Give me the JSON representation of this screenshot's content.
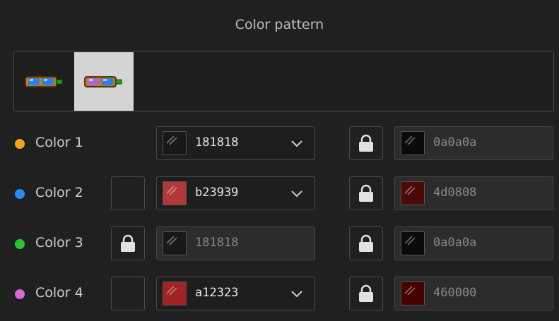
{
  "title": "Color pattern",
  "patterns": [
    {
      "name": "goggles-pattern-1",
      "selected": false
    },
    {
      "name": "goggles-pattern-2",
      "selected": true
    }
  ],
  "rows": [
    {
      "label": "Color 1",
      "dot_color": "#f5a31a",
      "left_lock": "none",
      "main": {
        "hex": "181818",
        "swatch": "#181818",
        "dropdown": true
      },
      "shade": {
        "hex": "0a0a0a",
        "swatch": "#0a0a0a"
      }
    },
    {
      "label": "Color 2",
      "dot_color": "#2a8cf0",
      "left_lock": "unlocked",
      "main": {
        "hex": "b23939",
        "swatch": "#b23939",
        "dropdown": true
      },
      "shade": {
        "hex": "4d0808",
        "swatch": "#4d0808"
      }
    },
    {
      "label": "Color 3",
      "dot_color": "#2ec42e",
      "left_lock": "locked",
      "main": {
        "hex": "181818",
        "swatch": "#181818",
        "dropdown": false
      },
      "shade": {
        "hex": "0a0a0a",
        "swatch": "#0a0a0a"
      }
    },
    {
      "label": "Color 4",
      "dot_color": "#d46ad4",
      "left_lock": "unlocked",
      "main": {
        "hex": "a12323",
        "swatch": "#a12323",
        "dropdown": true
      },
      "shade": {
        "hex": "460000",
        "swatch": "#460000"
      }
    }
  ]
}
